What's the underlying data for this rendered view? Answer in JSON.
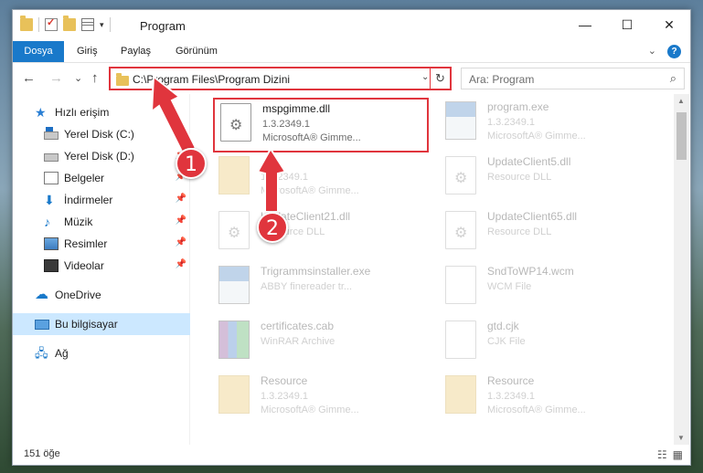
{
  "window": {
    "title": "Program",
    "controls": {
      "minimize": "—",
      "maximize": "☐",
      "close": "✕"
    }
  },
  "ribbon": {
    "tabs": [
      "Dosya",
      "Giriş",
      "Paylaş",
      "Görünüm"
    ],
    "expand_icon": "⌄",
    "help_icon": "?"
  },
  "nav": {
    "back": "←",
    "forward": "→",
    "recent": "⌄",
    "up": "↑",
    "address": "C:\\Program Files\\Program Dizini",
    "search_placeholder": "Ara: Program"
  },
  "sidebar": {
    "items": [
      {
        "label": "Hızlı erişim",
        "icon": "star-icon"
      },
      {
        "label": "Yerel Disk (C:)",
        "icon": "drive-icon",
        "pinned": true
      },
      {
        "label": "Yerel Disk (D:)",
        "icon": "drive-icon",
        "pinned": true
      },
      {
        "label": "Belgeler",
        "icon": "documents-icon",
        "pinned": true
      },
      {
        "label": "İndirmeler",
        "icon": "download-icon",
        "pinned": true
      },
      {
        "label": "Müzik",
        "icon": "music-icon",
        "pinned": true
      },
      {
        "label": "Resimler",
        "icon": "pictures-icon",
        "pinned": true
      },
      {
        "label": "Videolar",
        "icon": "videos-icon",
        "pinned": true
      },
      {
        "label": "OneDrive",
        "icon": "onedrive-icon"
      },
      {
        "label": "Bu bilgisayar",
        "icon": "computer-icon",
        "active": true
      },
      {
        "label": "Ağ",
        "icon": "network-icon"
      }
    ]
  },
  "files": [
    {
      "name": "mspgimme.dll",
      "line1": "1.3.2349.1",
      "line2": "MicrosoftA® Gimme...",
      "icon": "dll-icon",
      "selected": true
    },
    {
      "name": "program.exe",
      "line1": "1.3.2349.1",
      "line2": "MicrosoftA® Gimme...",
      "icon": "exe-icon"
    },
    {
      "name": "",
      "line1": "1.3.2349.1",
      "line2": "MicrosoftA® Gimme...",
      "icon": "folder-icon"
    },
    {
      "name": "UpdateClient5.dll",
      "line1": "Resource DLL",
      "line2": "",
      "icon": "dll-icon"
    },
    {
      "name": "UpdateClient21.dll",
      "line1": "Resource DLL",
      "line2": "",
      "icon": "dll-icon"
    },
    {
      "name": "UpdateClient65.dll",
      "line1": "Resource DLL",
      "line2": "",
      "icon": "dll-icon"
    },
    {
      "name": "Trigrammsinstaller.exe",
      "line1": "ABBY finereader tr...",
      "line2": "",
      "icon": "exe-icon"
    },
    {
      "name": "SndToWP14.wcm",
      "line1": "WCM File",
      "line2": "",
      "icon": "file-icon"
    },
    {
      "name": "certificates.cab",
      "line1": "WinRAR Archive",
      "line2": "",
      "icon": "archive-icon"
    },
    {
      "name": "gtd.cjk",
      "line1": "CJK File",
      "line2": "",
      "icon": "file-icon"
    },
    {
      "name": "Resource",
      "line1": "1.3.2349.1",
      "line2": "MicrosoftA® Gimme...",
      "icon": "folder-icon"
    },
    {
      "name": "Resource",
      "line1": "1.3.2349.1",
      "line2": "MicrosoftA® Gimme...",
      "icon": "folder-icon"
    }
  ],
  "status": {
    "count": "151 öğe"
  },
  "annotations": {
    "step1": "1",
    "step2": "2",
    "color": "#e0353d"
  }
}
